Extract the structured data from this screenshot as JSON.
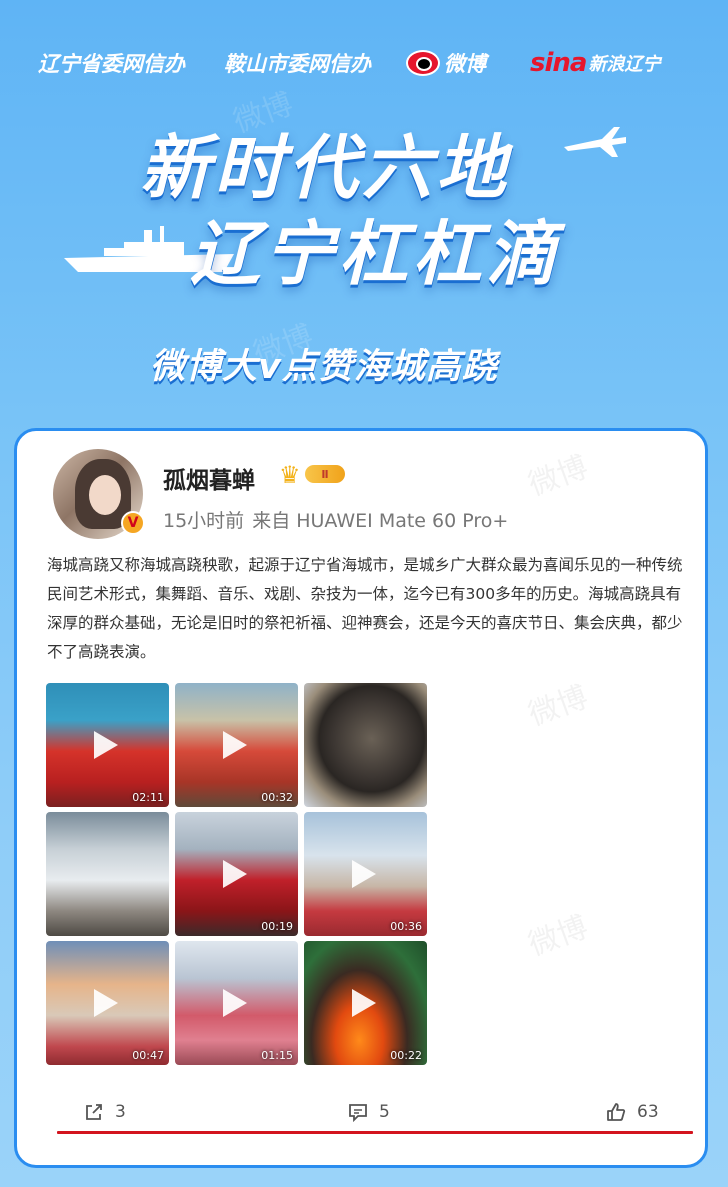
{
  "header": {
    "org1": "辽宁省委网信办",
    "org2": "鞍山市委网信办",
    "weibo_label": "微博",
    "sina_label": "sina",
    "sina_sub": "新浪辽宁"
  },
  "title": {
    "line1": "新时代六地",
    "line2": "辽宁杠杠滴",
    "subtitle": "微博大v点赞海城高跷"
  },
  "watermark": "微博",
  "post": {
    "username": "孤烟暮蝉",
    "verified_mark": "V",
    "level_badge": "Ⅱ",
    "time": "15小时前",
    "source": "来自 HUAWEI Mate 60 Pro+",
    "text": "海城高跷又称海城高跷秧歌，起源于辽宁省海城市，是城乡广大群众最为喜闻乐见的一种传统民间艺术形式，集舞蹈、音乐、戏剧、杂技为一体，迄今已有300多年的历史。海城高跷具有深厚的群众基础，无论是旧时的祭祀祈福、迎神赛会，还是今天的喜庆节日、集会庆典，都少不了高跷表演。",
    "videos": [
      {
        "duration": "02:11"
      },
      {
        "duration": "00:32"
      },
      {
        "duration": ""
      },
      {
        "duration": ""
      },
      {
        "duration": "00:19"
      },
      {
        "duration": "00:36"
      },
      {
        "duration": "00:47"
      },
      {
        "duration": "01:15"
      },
      {
        "duration": "00:22"
      }
    ],
    "shares": "3",
    "comments": "5",
    "likes": "63"
  },
  "colors": {
    "accent_blue": "#2a8df0",
    "weibo_red": "#e6162d",
    "underline_red": "#d3141e"
  }
}
